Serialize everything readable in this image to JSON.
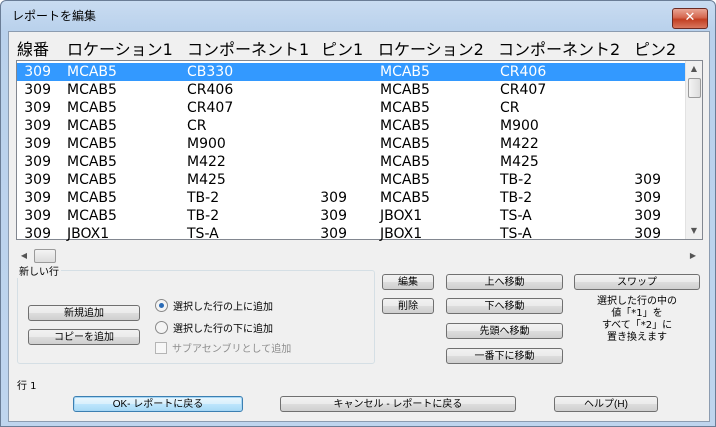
{
  "window": {
    "title": "レポートを編集",
    "close_glyph": "✕"
  },
  "columns": [
    "線番",
    "ロケーション1",
    "コンポーネント1",
    "ピン1",
    "ロケーション2",
    "コンポーネント2",
    "ピン2"
  ],
  "rows": [
    {
      "num": "309",
      "loc1": "MCAB5",
      "comp1": "CB330",
      "pin1": "",
      "loc2": "MCAB5",
      "comp2": "CR406",
      "pin2": "",
      "selected": true
    },
    {
      "num": "309",
      "loc1": "MCAB5",
      "comp1": "CR406",
      "pin1": "",
      "loc2": "MCAB5",
      "comp2": "CR407",
      "pin2": ""
    },
    {
      "num": "309",
      "loc1": "MCAB5",
      "comp1": "CR407",
      "pin1": "",
      "loc2": "MCAB5",
      "comp2": "CR",
      "pin2": ""
    },
    {
      "num": "309",
      "loc1": "MCAB5",
      "comp1": "CR",
      "pin1": "",
      "loc2": "MCAB5",
      "comp2": "M900",
      "pin2": ""
    },
    {
      "num": "309",
      "loc1": "MCAB5",
      "comp1": "M900",
      "pin1": "",
      "loc2": "MCAB5",
      "comp2": "M422",
      "pin2": ""
    },
    {
      "num": "309",
      "loc1": "MCAB5",
      "comp1": "M422",
      "pin1": "",
      "loc2": "MCAB5",
      "comp2": "M425",
      "pin2": ""
    },
    {
      "num": "309",
      "loc1": "MCAB5",
      "comp1": "M425",
      "pin1": "",
      "loc2": "MCAB5",
      "comp2": "TB-2",
      "pin2": "309"
    },
    {
      "num": "309",
      "loc1": "MCAB5",
      "comp1": "TB-2",
      "pin1": "309",
      "loc2": "MCAB5",
      "comp2": "TB-2",
      "pin2": "309"
    },
    {
      "num": "309",
      "loc1": "MCAB5",
      "comp1": "TB-2",
      "pin1": "309",
      "loc2": "JBOX1",
      "comp2": "TS-A",
      "pin2": "309"
    },
    {
      "num": "309",
      "loc1": "JBOX1",
      "comp1": "TS-A",
      "pin1": "309",
      "loc2": "JBOX1",
      "comp2": "TS-A",
      "pin2": "309"
    }
  ],
  "new_row_group": {
    "label": "新しい行",
    "new_add_button": "新規追加",
    "copy_add_button": "コピーを追加",
    "radio_above": "選択した行の上に追加",
    "radio_below": "選択した行の下に追加",
    "radio_selected": "above",
    "subassembly_checkbox": "サブアセンブリとして追加"
  },
  "actions": {
    "edit": "編集",
    "delete": "削除",
    "move_up": "上へ移動",
    "move_down": "下へ移動",
    "move_top": "先頭へ移動",
    "move_bottom": "一番下に移動",
    "swap": "スワップ"
  },
  "swap_note": [
    "選択した行の中の",
    "値「*1」を",
    "すべて「*2」に",
    "置き換えます"
  ],
  "status": {
    "row_label": "行 1"
  },
  "footer": {
    "ok": "OK- レポートに戻る",
    "cancel": "キャンセル - レポートに戻る",
    "help": "ヘルプ(H)"
  },
  "colors": {
    "selection": "#3399ff",
    "title_bg": "#bfd5ee",
    "close_btn": "#c23f22"
  }
}
